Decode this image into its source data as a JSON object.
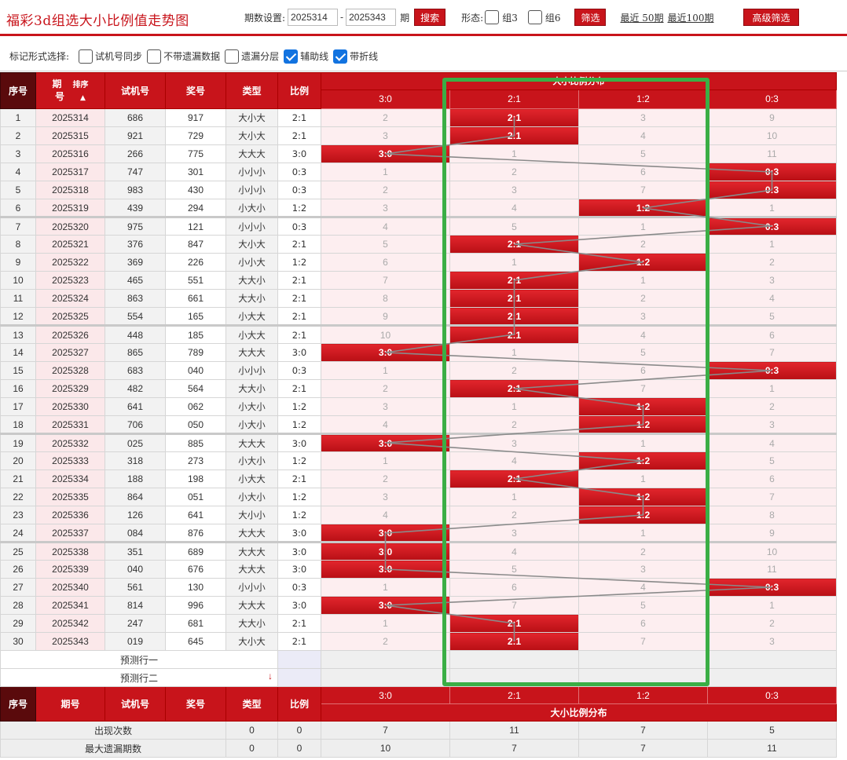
{
  "header": {
    "title": "福彩3d组选大小比例值走势图",
    "period_label": "期数设置:",
    "period_from": "2025314",
    "period_sep": "-",
    "period_to": "2025343",
    "period_unit": "期",
    "search_label": "搜索",
    "shape_label": "形态:",
    "group3_label": "组3",
    "group6_label": "组6",
    "filter_label": "筛选",
    "recent50_label": "最近 50期",
    "recent100_label": "最近100期",
    "advanced_label": "高级筛选"
  },
  "options": {
    "label": "标记形式选择:",
    "items": [
      {
        "label": "试机号同步",
        "checked": false
      },
      {
        "label": "不带遗漏数据",
        "checked": false
      },
      {
        "label": "遗漏分层",
        "checked": false
      },
      {
        "label": "辅助线",
        "checked": true
      },
      {
        "label": "带折线",
        "checked": true
      }
    ]
  },
  "columns": {
    "index": "序号",
    "period": "期号",
    "period_top": "期",
    "period_bottom": "号",
    "sort": "排序",
    "test": "试机号",
    "prize": "奖号",
    "type": "类型",
    "ratio": "比例",
    "dist_title": "大小比例分布",
    "dist": [
      "3:0",
      "2:1",
      "1:2",
      "0:3"
    ]
  },
  "rows": [
    {
      "idx": "1",
      "period": "2025314",
      "test": "686",
      "prize": "917",
      "type": "大小大",
      "ratio": "2:1",
      "cells": [
        "2",
        "2:1",
        "3",
        "9"
      ],
      "hit": 1
    },
    {
      "idx": "2",
      "period": "2025315",
      "test": "921",
      "prize": "729",
      "type": "大小大",
      "ratio": "2:1",
      "cells": [
        "3",
        "2:1",
        "4",
        "10"
      ],
      "hit": 1
    },
    {
      "idx": "3",
      "period": "2025316",
      "test": "266",
      "prize": "775",
      "type": "大大大",
      "ratio": "3:0",
      "cells": [
        "3:0",
        "1",
        "5",
        "11"
      ],
      "hit": 0
    },
    {
      "idx": "4",
      "period": "2025317",
      "test": "747",
      "prize": "301",
      "type": "小小小",
      "ratio": "0:3",
      "cells": [
        "1",
        "2",
        "6",
        "0:3"
      ],
      "hit": 3
    },
    {
      "idx": "5",
      "period": "2025318",
      "test": "983",
      "prize": "430",
      "type": "小小小",
      "ratio": "0:3",
      "cells": [
        "2",
        "3",
        "7",
        "0:3"
      ],
      "hit": 3
    },
    {
      "idx": "6",
      "period": "2025319",
      "test": "439",
      "prize": "294",
      "type": "小大小",
      "ratio": "1:2",
      "cells": [
        "3",
        "4",
        "1:2",
        "1"
      ],
      "hit": 2
    },
    {
      "idx": "7",
      "period": "2025320",
      "test": "975",
      "prize": "121",
      "type": "小小小",
      "ratio": "0:3",
      "cells": [
        "4",
        "5",
        "1",
        "0:3"
      ],
      "hit": 3
    },
    {
      "idx": "8",
      "period": "2025321",
      "test": "376",
      "prize": "847",
      "type": "大小大",
      "ratio": "2:1",
      "cells": [
        "5",
        "2:1",
        "2",
        "1"
      ],
      "hit": 1
    },
    {
      "idx": "9",
      "period": "2025322",
      "test": "369",
      "prize": "226",
      "type": "小小大",
      "ratio": "1:2",
      "cells": [
        "6",
        "1",
        "1:2",
        "2"
      ],
      "hit": 2
    },
    {
      "idx": "10",
      "period": "2025323",
      "test": "465",
      "prize": "551",
      "type": "大大小",
      "ratio": "2:1",
      "cells": [
        "7",
        "2:1",
        "1",
        "3"
      ],
      "hit": 1
    },
    {
      "idx": "11",
      "period": "2025324",
      "test": "863",
      "prize": "661",
      "type": "大大小",
      "ratio": "2:1",
      "cells": [
        "8",
        "2:1",
        "2",
        "4"
      ],
      "hit": 1
    },
    {
      "idx": "12",
      "period": "2025325",
      "test": "554",
      "prize": "165",
      "type": "小大大",
      "ratio": "2:1",
      "cells": [
        "9",
        "2:1",
        "3",
        "5"
      ],
      "hit": 1
    },
    {
      "idx": "13",
      "period": "2025326",
      "test": "448",
      "prize": "185",
      "type": "小大大",
      "ratio": "2:1",
      "cells": [
        "10",
        "2:1",
        "4",
        "6"
      ],
      "hit": 1
    },
    {
      "idx": "14",
      "period": "2025327",
      "test": "865",
      "prize": "789",
      "type": "大大大",
      "ratio": "3:0",
      "cells": [
        "3:0",
        "1",
        "5",
        "7"
      ],
      "hit": 0
    },
    {
      "idx": "15",
      "period": "2025328",
      "test": "683",
      "prize": "040",
      "type": "小小小",
      "ratio": "0:3",
      "cells": [
        "1",
        "2",
        "6",
        "0:3"
      ],
      "hit": 3
    },
    {
      "idx": "16",
      "period": "2025329",
      "test": "482",
      "prize": "564",
      "type": "大大小",
      "ratio": "2:1",
      "cells": [
        "2",
        "2:1",
        "7",
        "1"
      ],
      "hit": 1
    },
    {
      "idx": "17",
      "period": "2025330",
      "test": "641",
      "prize": "062",
      "type": "小大小",
      "ratio": "1:2",
      "cells": [
        "3",
        "1",
        "1:2",
        "2"
      ],
      "hit": 2
    },
    {
      "idx": "18",
      "period": "2025331",
      "test": "706",
      "prize": "050",
      "type": "小大小",
      "ratio": "1:2",
      "cells": [
        "4",
        "2",
        "1:2",
        "3"
      ],
      "hit": 2
    },
    {
      "idx": "19",
      "period": "2025332",
      "test": "025",
      "prize": "885",
      "type": "大大大",
      "ratio": "3:0",
      "cells": [
        "3:0",
        "3",
        "1",
        "4"
      ],
      "hit": 0
    },
    {
      "idx": "20",
      "period": "2025333",
      "test": "318",
      "prize": "273",
      "type": "小大小",
      "ratio": "1:2",
      "cells": [
        "1",
        "4",
        "1:2",
        "5"
      ],
      "hit": 2
    },
    {
      "idx": "21",
      "period": "2025334",
      "test": "188",
      "prize": "198",
      "type": "小大大",
      "ratio": "2:1",
      "cells": [
        "2",
        "2:1",
        "1",
        "6"
      ],
      "hit": 1
    },
    {
      "idx": "22",
      "period": "2025335",
      "test": "864",
      "prize": "051",
      "type": "小大小",
      "ratio": "1:2",
      "cells": [
        "3",
        "1",
        "1:2",
        "7"
      ],
      "hit": 2
    },
    {
      "idx": "23",
      "period": "2025336",
      "test": "126",
      "prize": "641",
      "type": "大小小",
      "ratio": "1:2",
      "cells": [
        "4",
        "2",
        "1:2",
        "8"
      ],
      "hit": 2
    },
    {
      "idx": "24",
      "period": "2025337",
      "test": "084",
      "prize": "876",
      "type": "大大大",
      "ratio": "3:0",
      "cells": [
        "3:0",
        "3",
        "1",
        "9"
      ],
      "hit": 0
    },
    {
      "idx": "25",
      "period": "2025338",
      "test": "351",
      "prize": "689",
      "type": "大大大",
      "ratio": "3:0",
      "cells": [
        "3:0",
        "4",
        "2",
        "10"
      ],
      "hit": 0
    },
    {
      "idx": "26",
      "period": "2025339",
      "test": "040",
      "prize": "676",
      "type": "大大大",
      "ratio": "3:0",
      "cells": [
        "3:0",
        "5",
        "3",
        "11"
      ],
      "hit": 0
    },
    {
      "idx": "27",
      "period": "2025340",
      "test": "561",
      "prize": "130",
      "type": "小小小",
      "ratio": "0:3",
      "cells": [
        "1",
        "6",
        "4",
        "0:3"
      ],
      "hit": 3
    },
    {
      "idx": "28",
      "period": "2025341",
      "test": "814",
      "prize": "996",
      "type": "大大大",
      "ratio": "3:0",
      "cells": [
        "3:0",
        "7",
        "5",
        "1"
      ],
      "hit": 0
    },
    {
      "idx": "29",
      "period": "2025342",
      "test": "247",
      "prize": "681",
      "type": "大大小",
      "ratio": "2:1",
      "cells": [
        "1",
        "2:1",
        "6",
        "2"
      ],
      "hit": 1
    },
    {
      "idx": "30",
      "period": "2025343",
      "test": "019",
      "prize": "645",
      "type": "大小大",
      "ratio": "2:1",
      "cells": [
        "2",
        "2:1",
        "7",
        "3"
      ],
      "hit": 1
    }
  ],
  "predict": {
    "row1": "预测行一",
    "row2": "预测行二",
    "arrow": "↓"
  },
  "stats": {
    "appear_label": "出现次数",
    "appear": [
      "0",
      "0",
      "7",
      "11",
      "7",
      "5"
    ],
    "maxmiss_label": "最大遗漏期数",
    "maxmiss": [
      "0",
      "0",
      "10",
      "7",
      "7",
      "11"
    ]
  },
  "colors": {
    "brand_red": "#c8141b",
    "highlight_green": "#3aae45",
    "checkbox_blue": "#1273e0"
  }
}
